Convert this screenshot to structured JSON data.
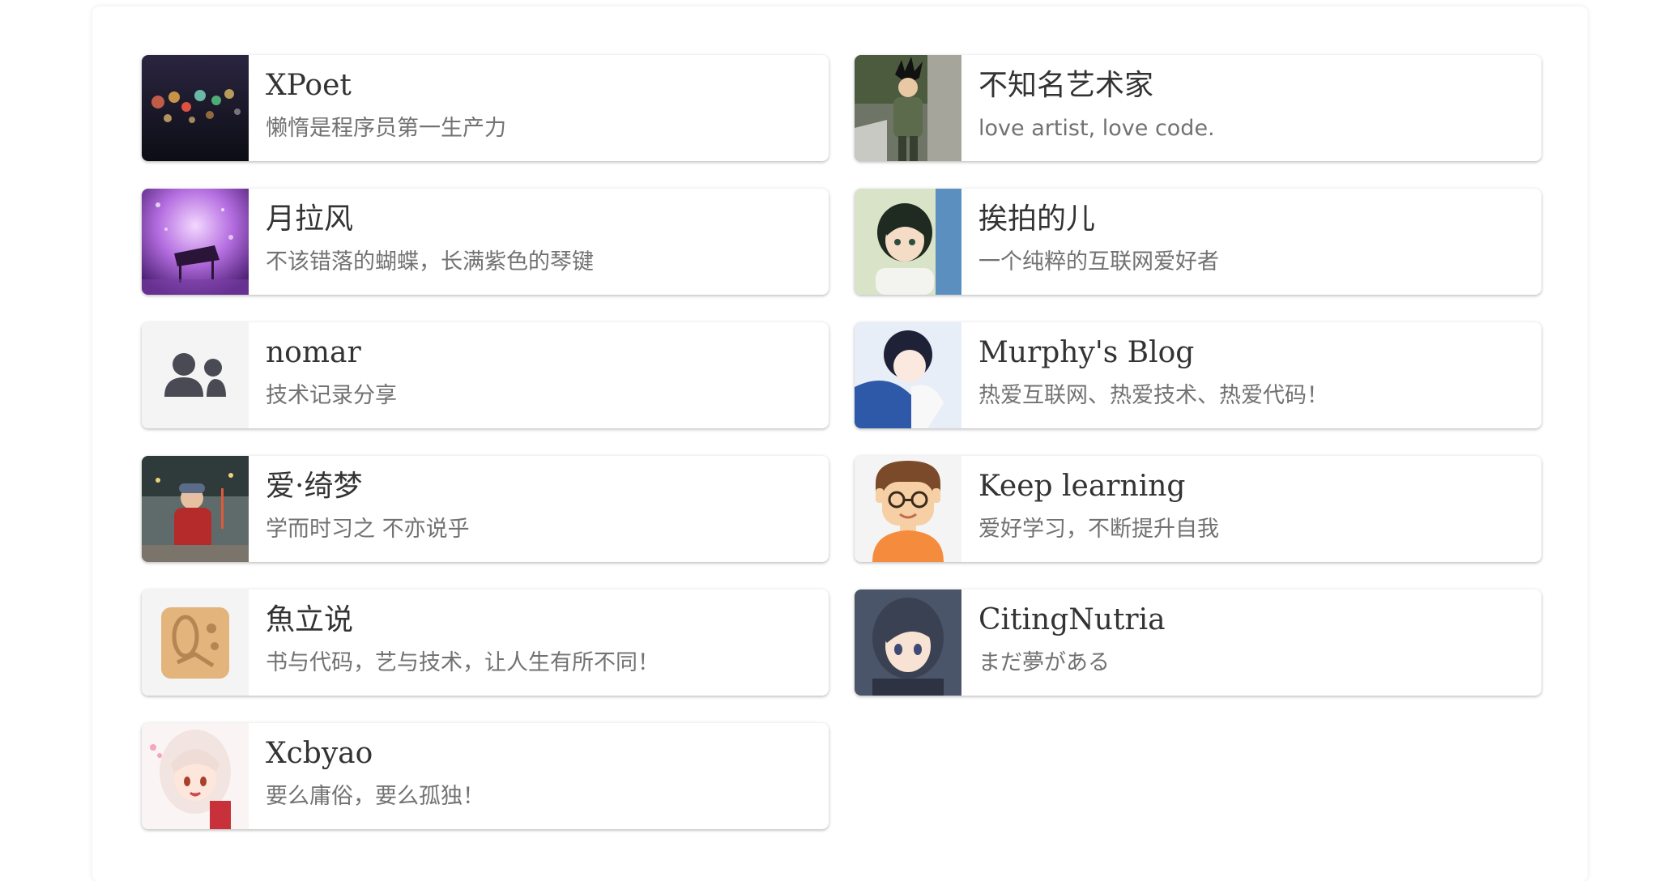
{
  "friends": [
    {
      "name": "XPoet",
      "desc": "懒惰是程序员第一生产力",
      "avatar": "bokeh-lights-avatar"
    },
    {
      "name": "不知名艺术家",
      "desc": "love artist, love code.",
      "avatar": "goku-avatar"
    },
    {
      "name": "月拉风",
      "desc": "不该错落的蝴蝶，长满紫色的琴键",
      "avatar": "purple-piano-avatar"
    },
    {
      "name": "挨拍的儿",
      "desc": "一个纯粹的互联网爱好者",
      "avatar": "anime-boy-avatar"
    },
    {
      "name": "nomar",
      "desc": "技术记录分享",
      "avatar": "users-icon"
    },
    {
      "name": "Murphy's Blog",
      "desc": "热爱互联网、热爱技术、热爱代码！",
      "avatar": "anime-sleeping-avatar"
    },
    {
      "name": "爱·绮梦",
      "desc": "学而时习之 不亦说乎",
      "avatar": "child-photo-avatar"
    },
    {
      "name": "Keep learning",
      "desc": "爱好学习，不断提升自我",
      "avatar": "glasses-boy-avatar"
    },
    {
      "name": "魚立说",
      "desc": "书与代码，艺与技术，让人生有所不同！",
      "avatar": "fish-seal-avatar"
    },
    {
      "name": "CitingNutria",
      "desc": "まだ夢がある",
      "avatar": "anime-girl-avatar"
    },
    {
      "name": "Xcbyao",
      "desc": "要么庸俗，要么孤独！",
      "avatar": "anime-white-hair-avatar"
    }
  ]
}
